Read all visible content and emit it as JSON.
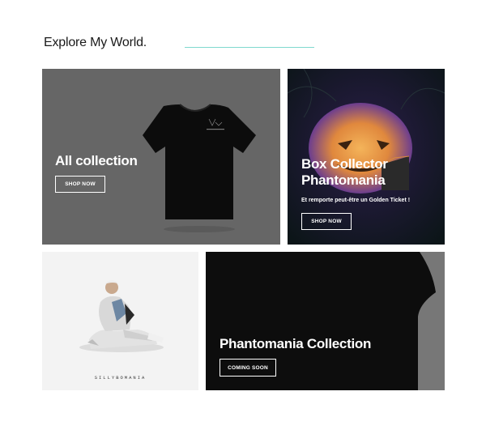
{
  "section": {
    "title": "Explore My World."
  },
  "cards": [
    {
      "heading": "All collection",
      "button": "SHOP NOW"
    },
    {
      "heading_line1": "Box Collector",
      "heading_line2": "Phantomania",
      "subtitle": "Et remporte peut-être un Golden Ticket !",
      "button": "SHOP NOW"
    },
    {
      "caption": "SILLYBOMANIA"
    },
    {
      "heading": "Phantomania Collection",
      "button": "COMING SOON"
    }
  ]
}
